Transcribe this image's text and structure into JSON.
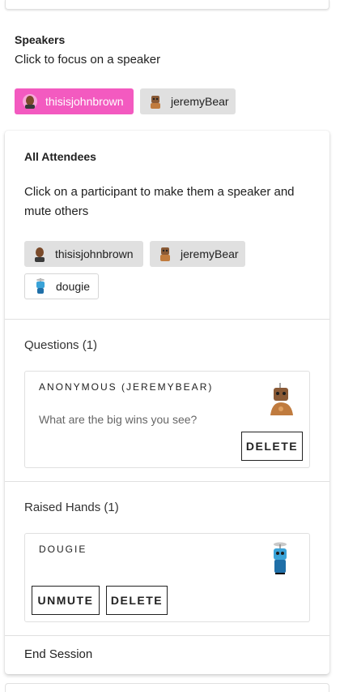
{
  "speakers": {
    "heading": "Speakers",
    "subtitle": "Click to focus on a speaker",
    "chips": [
      {
        "label": "thisisjohnbrown",
        "active": true
      },
      {
        "label": "jeremyBear",
        "active": false
      }
    ]
  },
  "attendees": {
    "heading": "All Attendees",
    "description": "Click on a participant to make them a speaker and mute others",
    "chips": [
      {
        "label": "thisisjohnbrown"
      },
      {
        "label": "jeremyBear"
      },
      {
        "label": "dougie"
      }
    ]
  },
  "questions": {
    "title": "Questions (1)",
    "items": [
      {
        "name": "ANONYMOUS (JEREMYBEAR)",
        "text": "What are the big wins you see?",
        "delete_label": "DELETE"
      }
    ]
  },
  "raised_hands": {
    "title": "Raised Hands (1)",
    "items": [
      {
        "name": "DOUGIE",
        "unmute_label": "UNMUTE",
        "delete_label": "DELETE"
      }
    ]
  },
  "end_session_label": "End Session",
  "colors": {
    "accent_chip": "#f35ac0",
    "chip_bg": "#e0e0e0"
  }
}
